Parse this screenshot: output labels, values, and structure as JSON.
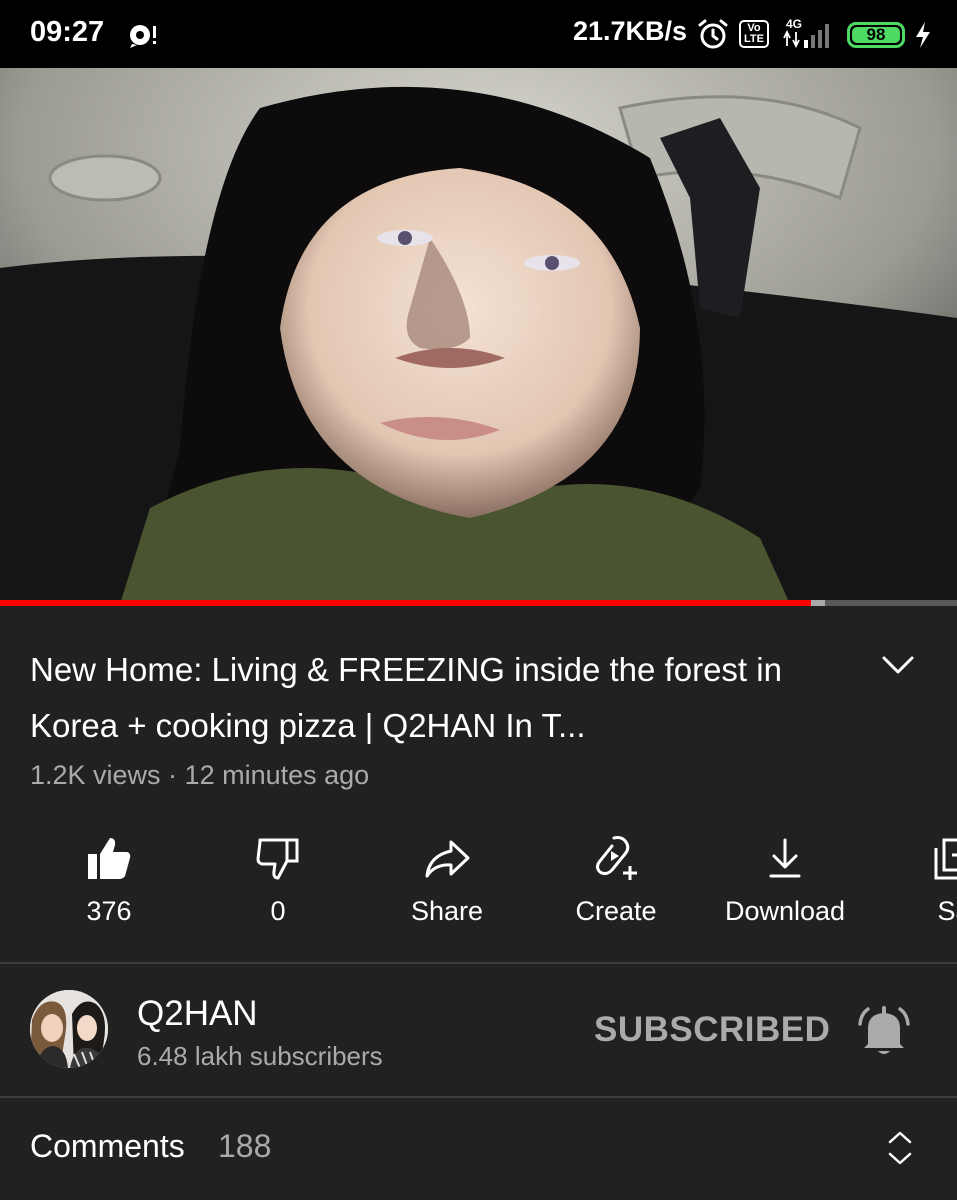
{
  "status_bar": {
    "time": "09:27",
    "network_speed": "21.7KB/s",
    "volte_label": "Vo\nLTE",
    "network_type": "4G",
    "battery_level": "98",
    "icons": [
      "notification-icon",
      "alarm-icon",
      "volte-icon",
      "signal-icon",
      "battery-icon",
      "charging-icon"
    ],
    "battery_color": "#4cd964"
  },
  "player": {
    "progress_fraction": 0.847,
    "buffer_fraction": 0.862,
    "progress_color": "#ff0000"
  },
  "video": {
    "title": "New Home: Living & FREEZING inside the forest in Korea + cooking pizza | Q2HAN In T...",
    "meta": "1.2K views · 12 minutes ago"
  },
  "actions": [
    {
      "label": "376",
      "icon": "thumbs-up-icon"
    },
    {
      "label": "0",
      "icon": "thumbs-down-icon"
    },
    {
      "label": "Share",
      "icon": "share-icon"
    },
    {
      "label": "Create",
      "icon": "create-icon"
    },
    {
      "label": "Download",
      "icon": "download-icon"
    },
    {
      "label": "Sa",
      "icon": "save-icon"
    }
  ],
  "channel": {
    "name": "Q2HAN",
    "subscribers": "6.48 lakh subscribers",
    "subscribe_state": "SUBSCRIBED",
    "icon": "bell-icon"
  },
  "comments": {
    "label": "Comments",
    "count": "188",
    "icon": "expand-collapse-icon"
  },
  "theme": {
    "background": "#212121",
    "secondary_text": "#aaaaaa"
  }
}
